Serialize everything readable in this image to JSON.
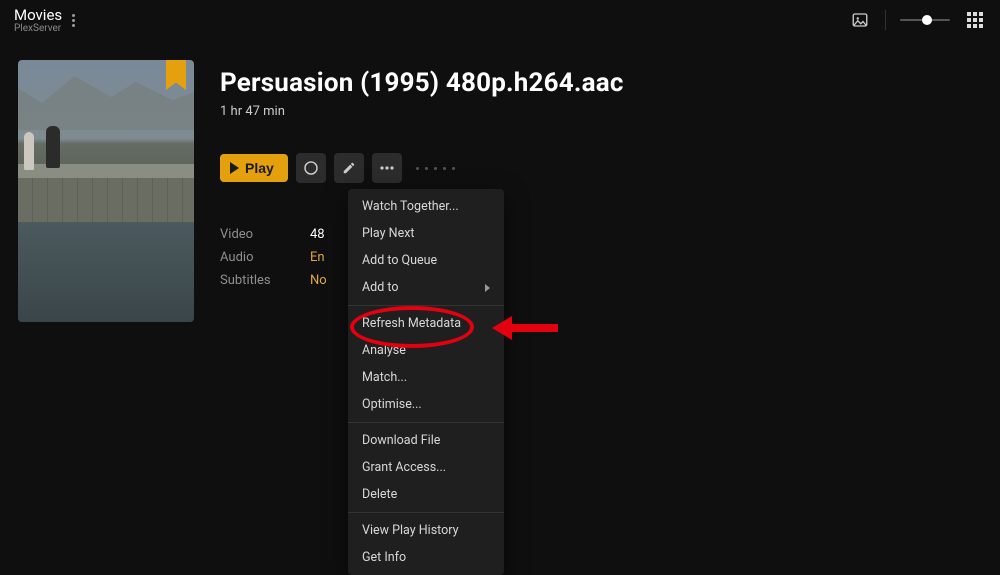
{
  "header": {
    "library": "Movies",
    "server": "PlexServer"
  },
  "movie": {
    "title": "Persuasion (1995) 480p.h264.aac",
    "duration": "1 hr 47 min"
  },
  "actions": {
    "play": "Play"
  },
  "meta": {
    "video_label": "Video",
    "video_value": "48",
    "audio_label": "Audio",
    "audio_value": "En",
    "subs_label": "Subtitles",
    "subs_value": "No"
  },
  "menu": {
    "watch_together": "Watch Together...",
    "play_next": "Play Next",
    "add_to_queue": "Add to Queue",
    "add_to": "Add to",
    "refresh_metadata": "Refresh Metadata",
    "analyse": "Analyse",
    "match": "Match...",
    "optimise": "Optimise...",
    "download_file": "Download File",
    "grant_access": "Grant Access...",
    "delete": "Delete",
    "view_play_history": "View Play History",
    "get_info": "Get Info"
  }
}
